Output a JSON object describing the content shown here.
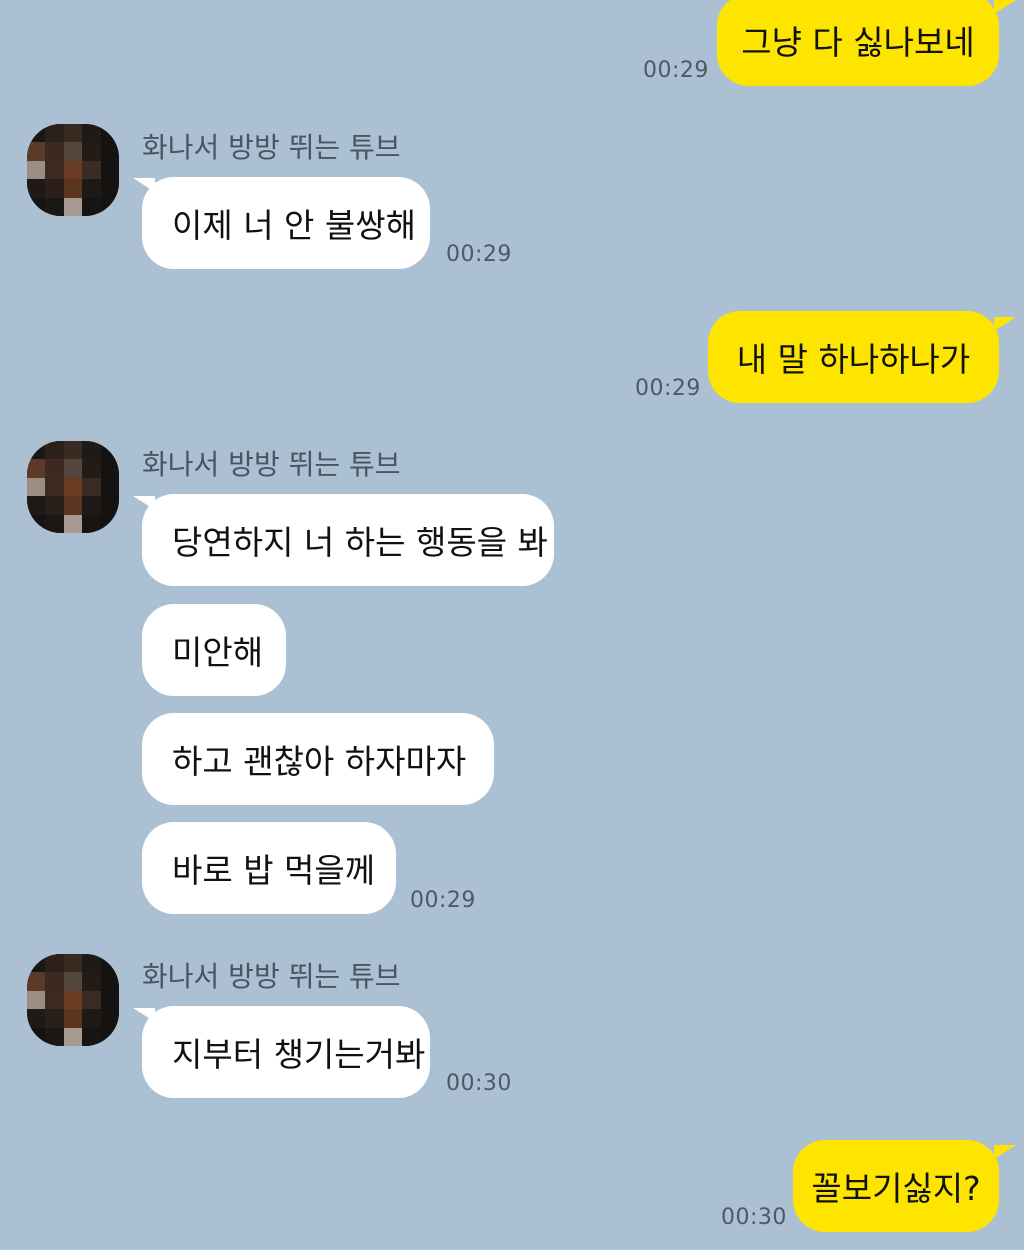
{
  "colors": {
    "background": "#abc0d3",
    "my_bubble": "#fee500",
    "their_bubble": "#ffffff"
  },
  "messages": [
    {
      "type": "sent",
      "text": "그냥 다 싫나보네",
      "time": "00:29"
    },
    {
      "type": "received",
      "sender": "화나서 방방 뛰는 튜브",
      "avatar_icon": "pixelated-avatar-icon",
      "text": "이제 너 안 불쌍해",
      "time": "00:29"
    },
    {
      "type": "sent",
      "text": "내 말 하나하나가",
      "time": "00:29"
    },
    {
      "type": "received_group",
      "sender": "화나서 방방 뛰는 튜브",
      "avatar_icon": "pixelated-avatar-icon",
      "lines": [
        "당연하지 너 하는 행동을 봐",
        "미안해",
        "하고 괜찮아 하자마자",
        "바로 밥 먹을께"
      ],
      "time": "00:29"
    },
    {
      "type": "received",
      "sender": "화나서 방방 뛰는 튜브",
      "avatar_icon": "pixelated-avatar-icon",
      "text": "지부터 챙기는거봐",
      "time": "00:30"
    },
    {
      "type": "sent",
      "text": "꼴보기싫지?",
      "time": "00:30"
    }
  ]
}
